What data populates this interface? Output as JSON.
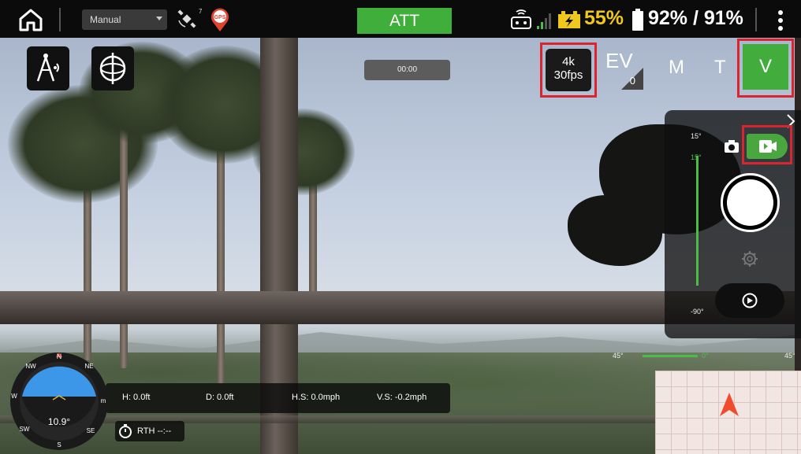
{
  "topbar": {
    "flight_mode": "Manual",
    "satellite_count": "7",
    "gps_badge": "GPS",
    "attitude_mode": "ATT",
    "rc_battery": "55%",
    "aircraft_battery": "92% / 91%",
    "icons": [
      "home-icon",
      "satellite-icon",
      "gps-icon",
      "remote-controller-icon",
      "signal-bars-icon",
      "battery-charging-icon",
      "battery-icon",
      "more-vert-icon"
    ]
  },
  "camera": {
    "record_time": "00:00",
    "resolution_line1": "4k",
    "resolution_line2": "30fps",
    "ev_label": "EV",
    "ev_value": "0",
    "lens_m": "M",
    "lens_t": "T",
    "lens_v": "V",
    "gimbal_top_label": "15°",
    "gimbal_current_label": "15°",
    "gimbal_bottom_label": "-90°",
    "yaw_left_label": "45°",
    "yaw_center_label": "0°",
    "yaw_right_label": "45°",
    "gimbal_pitch_fraction": 1.0
  },
  "telemetry": {
    "height": "H: 0.0ft",
    "distance": "D: 0.0ft",
    "h_speed": "H.S: 0.0mph",
    "v_speed": "V.S: -0.2mph",
    "rth": "RTH --:--"
  },
  "compass": {
    "heading": "10.9°",
    "n": "N",
    "ne": "NE",
    "nw": "NW",
    "w": "W",
    "sw": "SW",
    "s": "S",
    "se": "SE",
    "m": "m"
  },
  "colors": {
    "accent_green": "#42ad3d",
    "highlight_red": "#d9252f",
    "battery_yellow": "#f0c81d"
  }
}
